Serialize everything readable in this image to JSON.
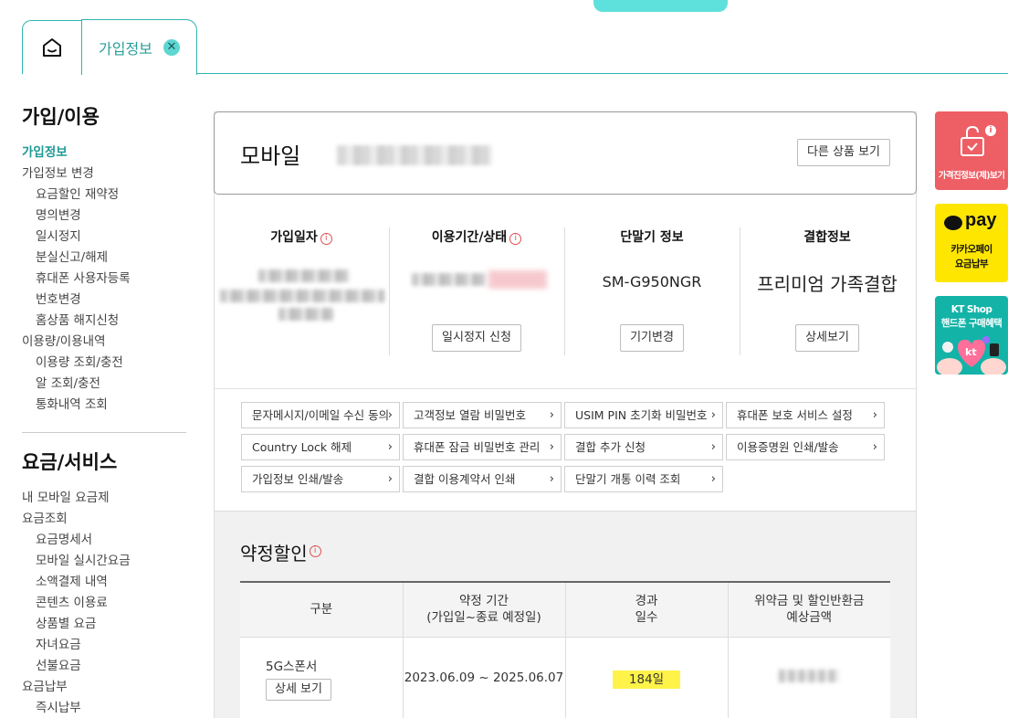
{
  "tabs": {
    "info_label": "가입정보",
    "close_glyph": "✕"
  },
  "sidebar": {
    "section1_title": "가입/이용",
    "section1_items": [
      {
        "label": "가입정보",
        "active": true
      },
      {
        "label": "가입정보 변경"
      },
      {
        "label": "요금할인 재약정",
        "sub": true
      },
      {
        "label": "명의변경",
        "sub": true
      },
      {
        "label": "일시정지",
        "sub": true
      },
      {
        "label": "분실신고/해제",
        "sub": true
      },
      {
        "label": "휴대폰 사용자등록",
        "sub": true
      },
      {
        "label": "번호변경",
        "sub": true
      },
      {
        "label": "홈상품 해지신청",
        "sub": true
      },
      {
        "label": "이용량/이용내역"
      },
      {
        "label": "이용량 조회/충전",
        "sub": true
      },
      {
        "label": "알 조회/충전",
        "sub": true
      },
      {
        "label": "통화내역 조회",
        "sub": true
      }
    ],
    "section2_title": "요금/서비스",
    "section2_items": [
      {
        "label": "내 모바일 요금제"
      },
      {
        "label": "요금조회"
      },
      {
        "label": "요금명세서",
        "sub": true
      },
      {
        "label": "모바일 실시간요금",
        "sub": true
      },
      {
        "label": "소액결제 내역",
        "sub": true
      },
      {
        "label": "콘텐츠 이용료",
        "sub": true
      },
      {
        "label": "상품별 요금",
        "sub": true
      },
      {
        "label": "자녀요금",
        "sub": true
      },
      {
        "label": "선불요금",
        "sub": true
      },
      {
        "label": "요금납부"
      },
      {
        "label": "즉시납부",
        "sub": true
      }
    ]
  },
  "main": {
    "mobile_title": "모바일",
    "other_products_btn": "다른 상품 보기",
    "cols": [
      {
        "head": "가입일자",
        "info": true
      },
      {
        "head": "이용기간/상태",
        "info": true,
        "button": "일시정지 신청"
      },
      {
        "head": "단말기 정보",
        "value": "SM-G950NGR",
        "button": "기기변경"
      },
      {
        "head": "결합정보",
        "value": "프리미엄 가족결합",
        "button": "상세보기"
      }
    ],
    "links": [
      "문자메시지/이메일 수신 동의",
      "고객정보 열람 비밀번호",
      "USIM PIN 초기화 비밀번호",
      "휴대폰 보호 서비스 설정",
      "Country Lock 해제",
      "휴대폰 잠금 비밀번호 관리",
      "결합 추가 신청",
      "이용증명원 인쇄/발송",
      "가입정보 인쇄/발송",
      "결합 이용계약서 인쇄",
      "단말기 개통 이력 조회"
    ],
    "discount": {
      "title": "약정할인",
      "headers": [
        "구분",
        "약정 기간\n(가입일~종료 예정일)",
        "경과\n일수",
        "위약금 및 할인반환금\n예상금액"
      ],
      "row": {
        "type": "5G스폰서",
        "detail_btn": "상세 보기",
        "period": "2023.06.09 ~ 2025.06.07",
        "days": "184일"
      }
    }
  },
  "banners": {
    "b1_text": "가격진정보(제)보기",
    "b2_pay": "pay",
    "b2_text1": "카카오페이",
    "b2_text2": "요금납부",
    "b3_text1": "KT Shop",
    "b3_text2": "핸드폰 구매혜택",
    "b3_logo": "kt"
  },
  "colors": {
    "accent": "#2fb5b0",
    "highlight": "#fff34a",
    "banner_red": "#ee5e65",
    "banner_yellow": "#ffe600",
    "banner_teal": "#13b3a8"
  }
}
